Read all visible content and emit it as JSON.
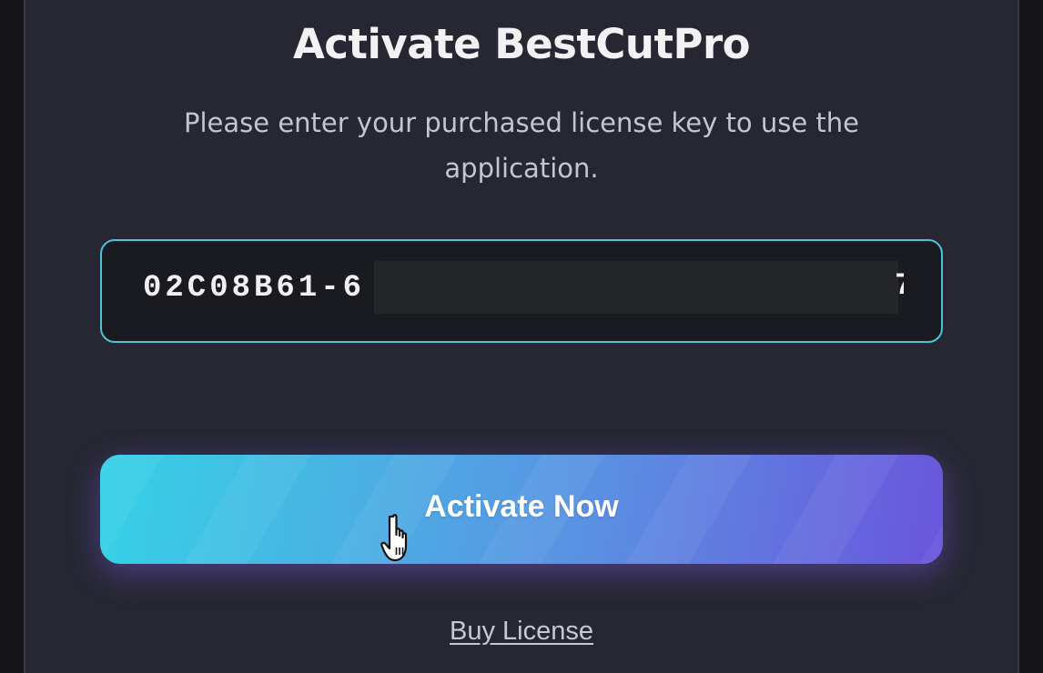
{
  "dialog": {
    "title": "Activate BestCutPro",
    "subtitle": "Please enter your purchased license key to use the application.",
    "license_key": {
      "visible_prefix": "02C08B61-6",
      "visible_suffix": "7",
      "redacted": true
    },
    "activate_label": "Activate Now",
    "buy_label": "Buy License"
  },
  "colors": {
    "background": "#272733",
    "input_border": "#4fc3d6",
    "button_gradient_start": "#35d2e6",
    "button_gradient_end": "#6a55dc"
  },
  "icons": {
    "cursor": "hand-pointer-icon"
  }
}
